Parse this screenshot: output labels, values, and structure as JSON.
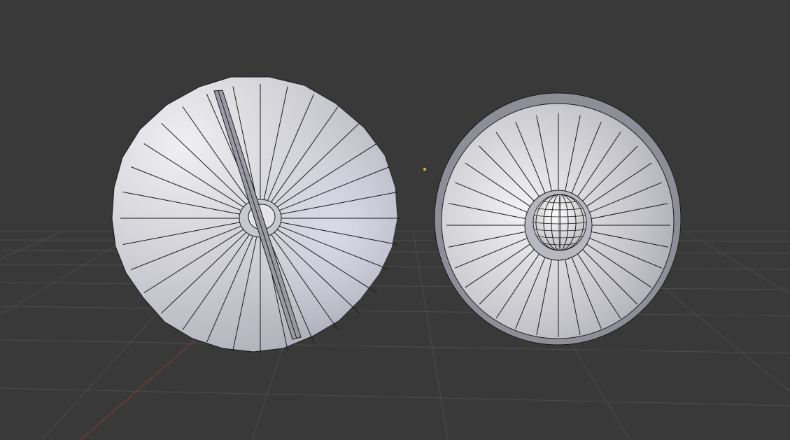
{
  "viewport": {
    "background": "#393939",
    "grid_color": "#4d4d4d",
    "x_axis_color": "#8a3a3a"
  },
  "objects": [
    {
      "name": "left-cone",
      "shape": "cone-with-slit",
      "segments": 32
    },
    {
      "name": "right-cone",
      "shape": "cone-with-sphere-tip",
      "segments": 32
    }
  ],
  "origin_marker": {
    "color": "#e8a33a"
  }
}
